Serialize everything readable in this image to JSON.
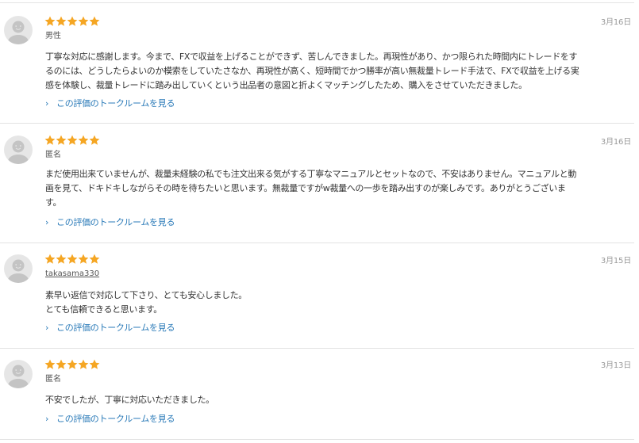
{
  "colors": {
    "star": "#f5a623",
    "link": "#2a7ab8",
    "divider": "#e3e3e3",
    "avatar_bg": "#e6e6e6",
    "date": "#999999"
  },
  "icons": {
    "avatar": "default-user-avatar-icon",
    "star": "star-icon",
    "chevron": "chevron-right-icon"
  },
  "reviews": [
    {
      "rating": 5,
      "date": "3月16日",
      "author": "男性",
      "author_is_link": false,
      "lines": [
        "丁寧な対応に感謝します。今まで、FXで収益を上げることができず、苦しんできました。再現性があり、かつ限られた時間内にトレードをす",
        "るのには、どうしたらよいのか模索をしていたさなか、再現性が高く、短時間でかつ勝率が高い無裁量トレード手法で、FXで収益を上げる実",
        "感を体験し、裁量トレードに踏み出していくという出品者の意図と折よくマッチングしたため、購入をさせていただきました。"
      ],
      "talk_link": "この評価のトークルームを見る"
    },
    {
      "rating": 5,
      "date": "3月16日",
      "author": "匿名",
      "author_is_link": false,
      "lines": [
        "まだ使用出来ていませんが、裁量未経験の私でも注文出来る気がする丁寧なマニュアルとセットなので、不安はありません。マニュアルと動",
        "画を見て、ドキドキしながらその時を待ちたいと思います。無裁量ですがw裁量への一歩を踏み出すのが楽しみです。ありがとうございま",
        "す。"
      ],
      "talk_link": "この評価のトークルームを見る"
    },
    {
      "rating": 5,
      "date": "3月15日",
      "author": "takasama330",
      "author_is_link": true,
      "lines": [
        "素早い返信で対応して下さり、とても安心しました。",
        "とても信頼できると思います。"
      ],
      "talk_link": "この評価のトークルームを見る"
    },
    {
      "rating": 5,
      "date": "3月13日",
      "author": "匿名",
      "author_is_link": false,
      "lines": [
        "不安でしたが、丁寧に対応いただきました。"
      ],
      "talk_link": "この評価のトークルームを見る"
    }
  ]
}
